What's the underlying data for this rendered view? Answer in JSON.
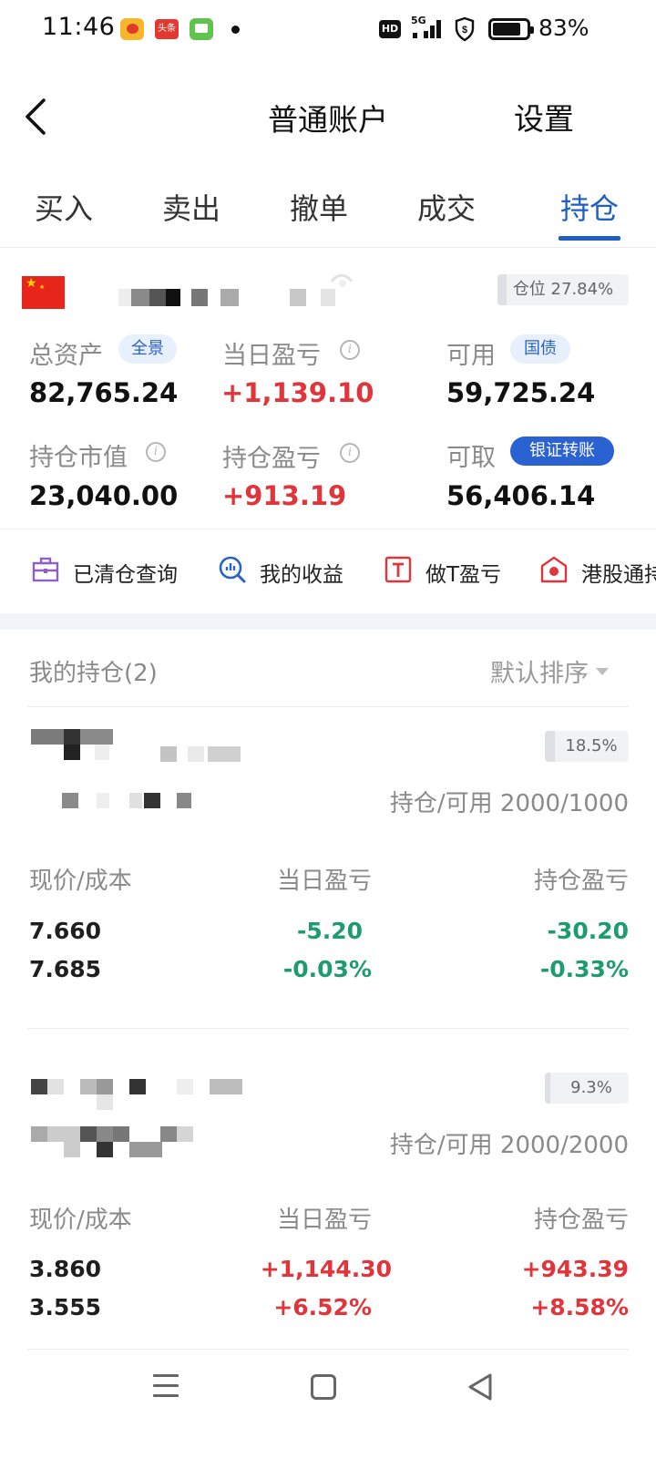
{
  "status_bar": {
    "time": "11:46",
    "toutiao_label": "头条",
    "hd": "HD",
    "network": "5G",
    "battery": "83%",
    "battery_level": 0.83,
    "icons": [
      "weibo-icon",
      "toutiao-icon",
      "message-icon",
      "hd-icon",
      "signal-icon",
      "shield-icon",
      "battery-icon"
    ]
  },
  "nav": {
    "title": "普通账户",
    "settings_label": "设置"
  },
  "tabs": [
    {
      "label": "买入"
    },
    {
      "label": "卖出"
    },
    {
      "label": "撤单"
    },
    {
      "label": "成交"
    },
    {
      "label": "持仓",
      "active": true
    }
  ],
  "account": {
    "position_ratio": "仓位 27.84%",
    "total_assets": {
      "label": "总资产",
      "value": "82,765.24",
      "tag": "全景"
    },
    "daily_pnl": {
      "label": "当日盈亏",
      "value": "+1,139.10"
    },
    "available": {
      "label": "可用",
      "value": "59,725.24",
      "tag": "国债"
    },
    "market_value": {
      "label": "持仓市值",
      "value": "23,040.00"
    },
    "holding_pnl": {
      "label": "持仓盈亏",
      "value": "+913.19"
    },
    "withdrawable": {
      "label": "可取",
      "value": "56,406.14",
      "tag": "银证转账"
    }
  },
  "quick_actions": [
    {
      "label": "已清仓查询",
      "icon": "briefcase-icon"
    },
    {
      "label": "我的收益",
      "icon": "chart-search-icon"
    },
    {
      "label": "做T盈亏",
      "icon": "t-box-icon"
    },
    {
      "label": "港股通持",
      "icon": "hk-flower-icon"
    }
  ],
  "holdings": {
    "title": "我的持仓(2)",
    "sort_label": "默认排序",
    "columns": [
      "现价/成本",
      "当日盈亏",
      "持仓盈亏"
    ],
    "items": [
      {
        "position_pct": "18.5%",
        "position_level": 0.185,
        "hold_avail": "持仓/可用 2000/1000",
        "price": "7.660",
        "cost": "7.685",
        "daily_pnl": "-5.20",
        "daily_pct": "-0.03%",
        "hold_pnl": "-30.20",
        "hold_pct": "-0.33%"
      },
      {
        "position_pct": "9.3%",
        "position_level": 0.093,
        "hold_avail": "持仓/可用 2000/2000",
        "price": "3.860",
        "cost": "3.555",
        "daily_pnl": "+1,144.30",
        "daily_pct": "+6.52%",
        "hold_pnl": "+943.39",
        "hold_pct": "+8.58%"
      }
    ]
  },
  "colors": {
    "accent": "#1f5fc4",
    "up": "#e0353b",
    "down": "#1e9c6e"
  }
}
